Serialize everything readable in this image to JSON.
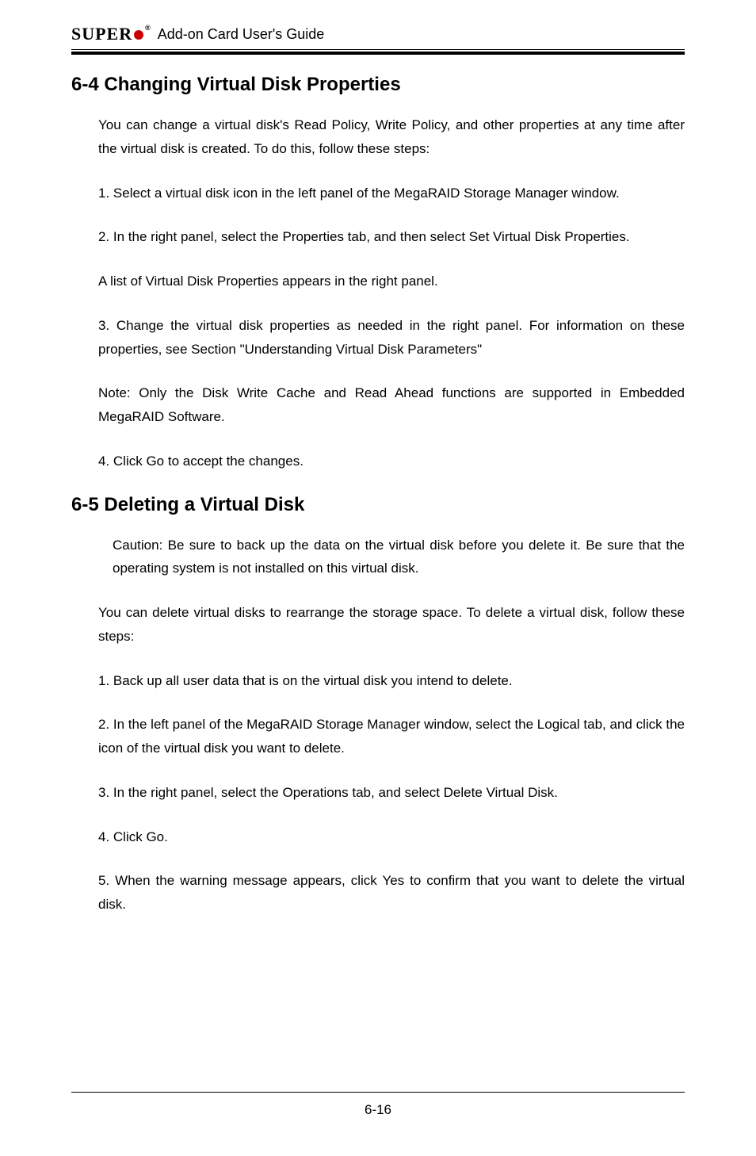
{
  "header": {
    "brand_letters": "SUPER",
    "brand_reg": "®",
    "guide_title": "Add-on Card User's Guide"
  },
  "section64": {
    "heading": "6-4 Changing Virtual Disk Properties",
    "p1": "You can change a virtual disk's Read Policy, Write Policy, and other properties at any time after the virtual disk is created. To do this, follow these steps:",
    "p2": "1. Select a virtual disk icon in the left panel of the MegaRAID Storage Manager window.",
    "p3": "2. In the right panel, select the Properties tab, and then select Set Virtual Disk Properties.",
    "p4": "A list of Virtual Disk Properties appears in the right panel.",
    "p5": "3. Change the virtual disk properties as needed in the right panel. For information on these properties, see Section \"Understanding Virtual Disk Parameters\"",
    "p6": "Note: Only the Disk Write Cache and Read Ahead functions are supported in Embedded MegaRAID Software.",
    "p7": "4. Click Go to accept the changes."
  },
  "section65": {
    "heading": "6-5 Deleting a Virtual Disk",
    "caution": "Caution: Be sure to back up the data on the virtual disk before you delete it. Be sure that the operating system is not installed on this virtual disk.",
    "p1": "You can delete virtual disks to rearrange the storage space. To delete a virtual disk, follow these steps:",
    "p2": "1. Back up all user data that is on the virtual disk you intend to delete.",
    "p3": "2. In the left panel of the MegaRAID Storage Manager window, select the Logical tab, and click the icon of the virtual disk you want to delete.",
    "p4": "3. In the right panel, select the Operations tab, and select Delete Virtual Disk.",
    "p5": "4. Click Go.",
    "p6": "5. When the warning message appears, click Yes to confirm that you  want to delete the virtual disk."
  },
  "footer": {
    "page_number": "6-16"
  }
}
